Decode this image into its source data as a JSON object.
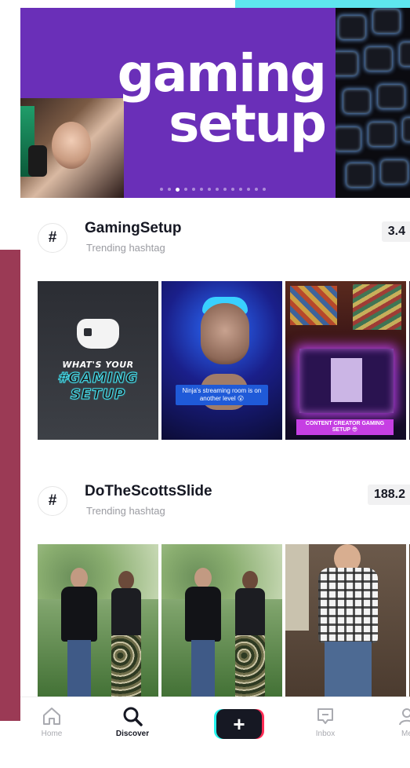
{
  "banner": {
    "title_line1": "gaming",
    "title_line2": "setup",
    "dots_total": 14,
    "dots_active_index": 2
  },
  "trending": [
    {
      "name": "GamingSetup",
      "subtitle": "Trending hashtag",
      "count": "3.4",
      "thumbnails": [
        {
          "line1": "WHAT'S YOUR",
          "line2": "#GAMING",
          "line3": "SETUP"
        },
        {
          "caption": "Ninja's streaming room is on another level 😮"
        },
        {
          "caption": "CONTENT CREATOR GAMING SETUP 😎"
        },
        {}
      ]
    },
    {
      "name": "DoTheScottsSlide",
      "subtitle": "Trending hashtag",
      "count": "188.2",
      "thumbnails": [
        {},
        {},
        {},
        {}
      ]
    }
  ],
  "bottom_nav": {
    "home": "Home",
    "discover": "Discover",
    "inbox": "Inbox",
    "me": "Me",
    "active": "discover"
  },
  "colors": {
    "banner_bg": "#6a2fb8",
    "tiktok_cyan": "#25f4ee",
    "tiktok_red": "#fe2c55",
    "text_primary": "#161823",
    "text_secondary": "#9a9ba1"
  }
}
